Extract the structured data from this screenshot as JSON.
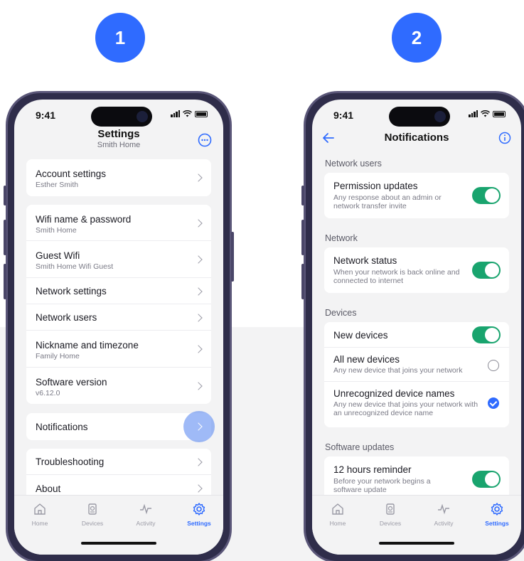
{
  "steps": {
    "one": "1",
    "two": "2"
  },
  "colors": {
    "accent": "#2f6bff",
    "toggle_on": "#19a46e"
  },
  "phone1": {
    "time": "9:41",
    "title": "Settings",
    "subtitle": "Smith Home",
    "menu_icon": "more-horizontal-circle-icon",
    "groups": [
      {
        "items": [
          {
            "label": "Account settings",
            "sub": "Esther Smith"
          }
        ]
      },
      {
        "items": [
          {
            "label": "Wifi name & password",
            "sub": "Smith Home"
          },
          {
            "label": "Guest Wifi",
            "sub": "Smith Home Wifi Guest"
          },
          {
            "label": "Network settings"
          },
          {
            "label": "Network users"
          },
          {
            "label": "Nickname and timezone",
            "sub": "Family Home"
          },
          {
            "label": "Software version",
            "sub": "v6.12.0"
          }
        ]
      },
      {
        "items": [
          {
            "label": "Notifications"
          }
        ]
      },
      {
        "items": [
          {
            "label": "Troubleshooting"
          },
          {
            "label": "About"
          }
        ]
      }
    ],
    "tabs": [
      {
        "label": "Home",
        "icon": "home-icon"
      },
      {
        "label": "Devices",
        "icon": "devices-icon"
      },
      {
        "label": "Activity",
        "icon": "activity-icon"
      },
      {
        "label": "Settings",
        "icon": "gear-icon",
        "active": true
      }
    ]
  },
  "phone2": {
    "time": "9:41",
    "title": "Notifications",
    "sections": [
      {
        "title": "Network users",
        "items": [
          {
            "label": "Permission updates",
            "sub": "Any response about an admin or network transfer invite",
            "control": "toggle-on"
          }
        ]
      },
      {
        "title": "Network",
        "items": [
          {
            "label": "Network status",
            "sub": "When your network is back online and connected to internet",
            "control": "toggle-on"
          }
        ]
      },
      {
        "title": "Devices",
        "items": [
          {
            "label": "New devices",
            "control": "toggle-on"
          },
          {
            "label": "All new devices",
            "sub": "Any new device that joins your network",
            "control": "radio-off"
          },
          {
            "label": "Unrecognized device names",
            "sub": "Any new device that joins your network with an unrecognized device name",
            "control": "radio-checked"
          }
        ]
      },
      {
        "title": "Software updates",
        "items": [
          {
            "label": "12 hours reminder",
            "sub": "Before your network begins a software update",
            "control": "toggle-on"
          }
        ]
      }
    ],
    "tabs": [
      {
        "label": "Home",
        "icon": "home-icon"
      },
      {
        "label": "Devices",
        "icon": "devices-icon"
      },
      {
        "label": "Activity",
        "icon": "activity-icon"
      },
      {
        "label": "Settings",
        "icon": "gear-icon",
        "active": true
      }
    ]
  }
}
